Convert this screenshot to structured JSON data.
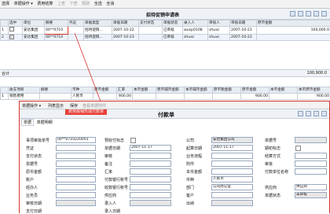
{
  "toolbar": {
    "items": [
      "选择",
      "单据操作 ▾",
      "费用结算",
      "上查",
      "下查",
      "帮助",
      "全选",
      "全消"
    ]
  },
  "list": {
    "title": "招待促销申请表",
    "columns": [
      "",
      "选中",
      "单位",
      "摘要",
      "凭证",
      "单据类型",
      "单据日期",
      "支付状态",
      "单据状态",
      "录入人",
      "审核人",
      "审核日期",
      "原币金额"
    ],
    "rows": [
      [
        "1",
        "",
        "安达集团",
        "00**0710",
        "",
        "招待促销...",
        "2007-10-22",
        "",
        "已审核",
        "wusp0108",
        "shuxc",
        "2007-10-23",
        "100,000.0"
      ],
      [
        "2",
        "",
        "安达集团",
        "00**0710",
        "",
        "招待促销...",
        "2007-10-23",
        "",
        "已审核",
        "shuxc",
        "shuxc",
        "2007-10-23",
        ""
      ]
    ],
    "total_label": "合计",
    "total_value": "100,900.0"
  },
  "detail": {
    "columns": [
      "",
      "收支项目",
      "摘要",
      "币种",
      "原币金额",
      "汇率",
      "本币金额",
      "原币辅币金额",
      "本币辅币金额",
      "原币税金额",
      "原币金额",
      "本币金额",
      "本币原币金额"
    ],
    "rows": [
      [
        "1",
        "销售费用",
        "",
        "人民币",
        "",
        "900.00",
        "",
        "",
        "",
        "",
        "900.00",
        "",
        "900.00"
      ]
    ]
  },
  "payment": {
    "toolbar": [
      "单据操作 ▾",
      "列表显示",
      "保存",
      "查看单据附件"
    ],
    "dialog_title": "费用报销形成付款单",
    "form_title": "付款单",
    "tabs": [
      "单据",
      "单据明细"
    ],
    "fields": {
      "source_no_label": "事项审批单号",
      "source_no": "00**0710220001",
      "prepay_label": "预收付标志",
      "company_label": "公司",
      "company": "安达集团公司",
      "doc_no_label": "单据号",
      "voucher_label": "凭证",
      "doc_date_label": "单据日期",
      "doc_date": "2007-11-17",
      "due_date_label": "起算日期",
      "due_date": "2007-11-17",
      "overdue_label": "期初标志",
      "pay_status_label": "支付状态",
      "audit_label": "审核",
      "biz_flow_label": "业务流程",
      "settle_label": "结算方式",
      "ticket_no_label": "票据号",
      "note_label": "备注",
      "attach_label": "附件",
      "approve_label": "审批",
      "amount_label": "原币金额",
      "rate_label": "汇率",
      "local_amount_label": "本币金额",
      "pay_unit_label": "付款单位名称",
      "account_label": "账户",
      "currency_label": "币种",
      "currency": "人民币",
      "pay_account_label": "付款银行账号",
      "agent_label": "经办人",
      "bank_account_label": "收款银行账号",
      "dept_label": "部门",
      "dept": "公司办公室",
      "biz_staff_label": "业务员",
      "supplier_label": "供应商",
      "customer_label": "客户",
      "customer": "供应商",
      "verify_label": "审核日期",
      "entry_staff_label": "录入人",
      "cashier_label": "出纳",
      "entry_date_label": "录入日期",
      "pay_date_label": "支付日期",
      "status_label": "单据状态",
      "status_value": "未审核"
    }
  },
  "colors": {
    "accent_red": "#d9342b",
    "header_bg": "#e7ecf3",
    "border": "#c7cfd9"
  }
}
